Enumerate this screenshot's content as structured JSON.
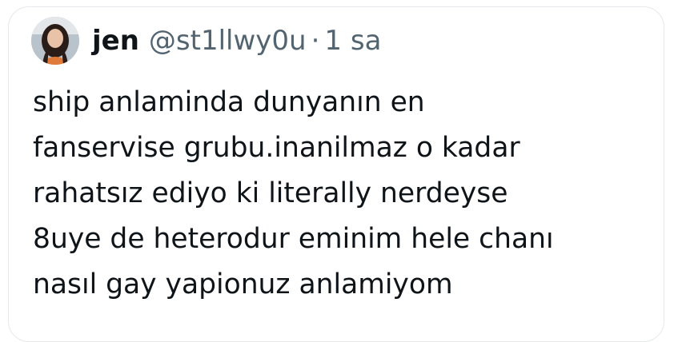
{
  "tweet": {
    "display_name": "jen",
    "handle": "@st1llwy0u",
    "separator": "·",
    "timestamp": "1 sa",
    "text_lines": [
      "ship anlaminda dunyanın en",
      "fanservise grubu.inanilmaz o kadar",
      "rahatsız ediyo ki literally nerdeyse",
      "8uye de heterodur eminim hele chanı",
      "nasıl gay yapionuz anlamiyom"
    ]
  },
  "colors": {
    "text_primary": "#0f1419",
    "text_secondary": "#536471",
    "border": "#e6e8eb"
  }
}
